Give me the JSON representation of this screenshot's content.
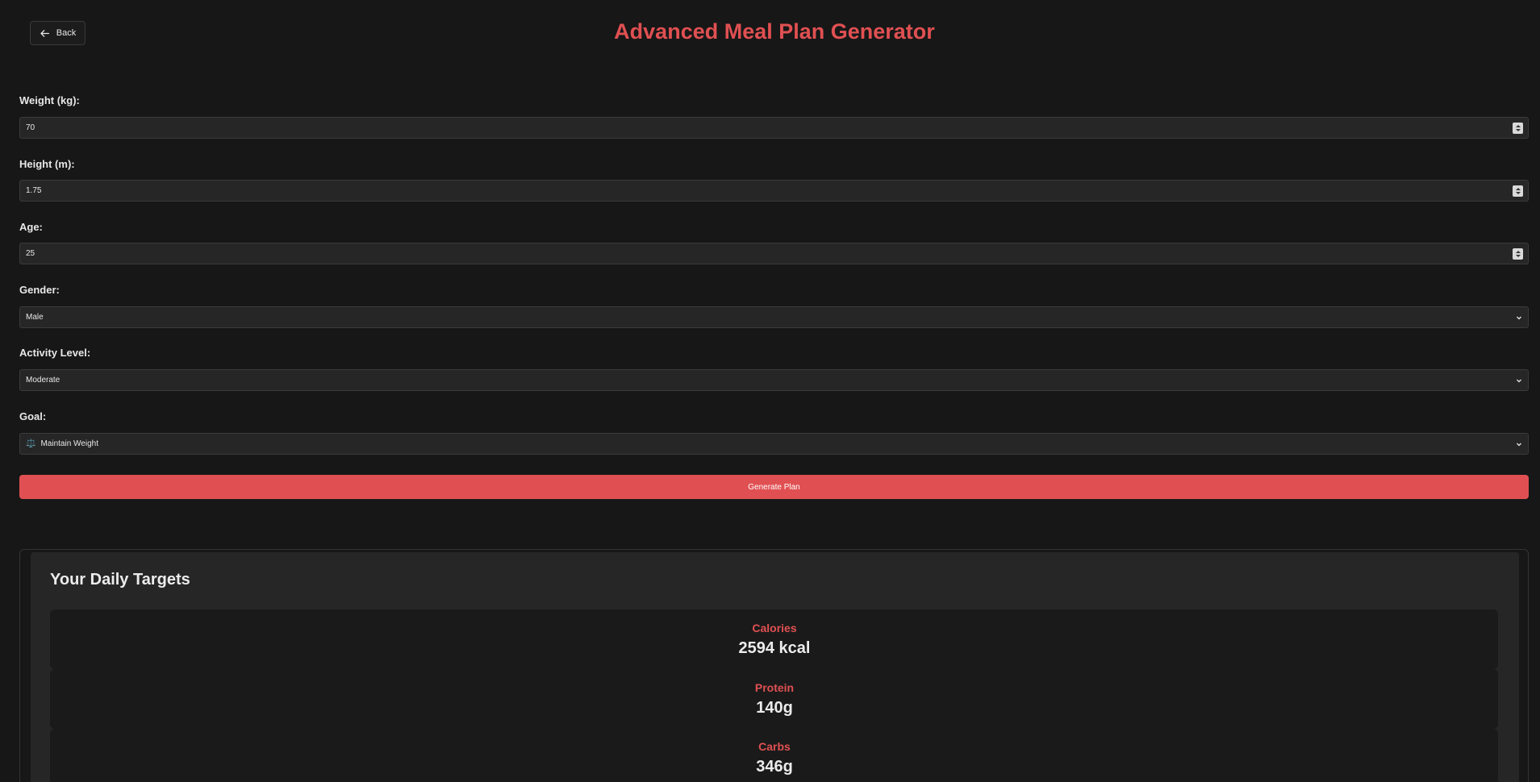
{
  "header": {
    "back_label": "Back",
    "title": "Advanced Meal Plan Generator"
  },
  "form": {
    "weight": {
      "label": "Weight (kg):",
      "value": "70"
    },
    "height": {
      "label": "Height (m):",
      "value": "1.75"
    },
    "age": {
      "label": "Age:",
      "value": "25"
    },
    "gender": {
      "label": "Gender:",
      "value": "Male"
    },
    "activity": {
      "label": "Activity Level:",
      "value": "Moderate"
    },
    "goal": {
      "label": "Goal:",
      "value": "Maintain Weight",
      "icon": "⚖️"
    },
    "generate_label": "Generate Plan"
  },
  "results": {
    "title": "Your Daily Targets",
    "targets": [
      {
        "label": "Calories",
        "value": "2594 kcal"
      },
      {
        "label": "Protein",
        "value": "140g"
      },
      {
        "label": "Carbs",
        "value": "346g"
      }
    ]
  },
  "colors": {
    "accent": "#e05052",
    "background": "#171717",
    "input_bg": "#262626"
  }
}
